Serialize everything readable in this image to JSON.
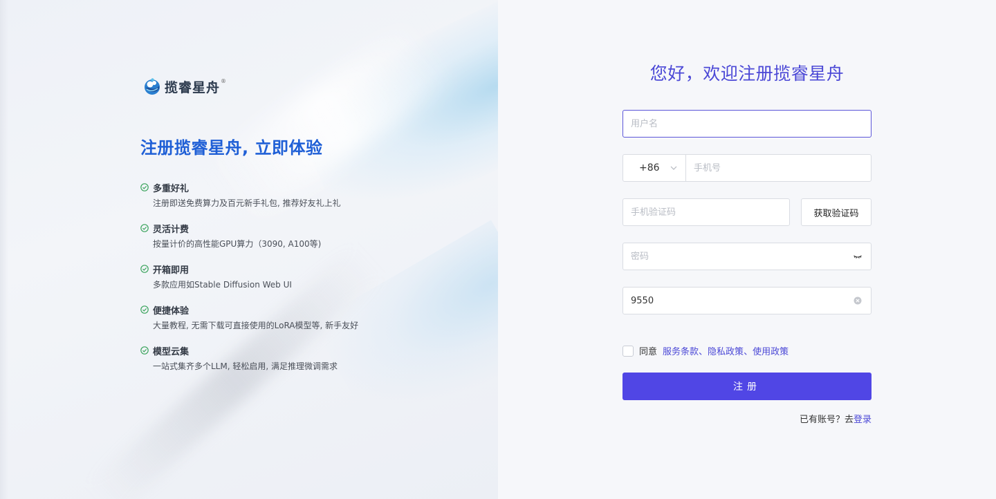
{
  "brand": {
    "logo_text": "揽睿星舟",
    "registered_mark": "®"
  },
  "hero": {
    "title": "注册揽睿星舟, 立即体验"
  },
  "features": [
    {
      "title": "多重好礼",
      "desc": "注册即送免费算力及百元新手礼包, 推荐好友礼上礼"
    },
    {
      "title": "灵活计费",
      "desc": "按量计价的高性能GPU算力（3090, A100等)"
    },
    {
      "title": "开箱即用",
      "desc": "多款应用如Stable Diffusion Web UI"
    },
    {
      "title": "便捷体验",
      "desc": "大量教程, 无需下载可直接使用的LoRA模型等, 新手友好"
    },
    {
      "title": "模型云集",
      "desc": "一站式集齐多个LLM, 轻松启用, 满足推理微调需求"
    }
  ],
  "form": {
    "title": "您好，欢迎注册揽睿星舟",
    "username": {
      "placeholder": "用户名",
      "value": ""
    },
    "country_code": "+86",
    "phone": {
      "placeholder": "手机号",
      "value": ""
    },
    "sms_code": {
      "placeholder": "手机验证码",
      "value": ""
    },
    "get_code_label": "获取验证码",
    "password": {
      "placeholder": "密码",
      "value": ""
    },
    "captcha": {
      "placeholder": "",
      "value": "9550"
    },
    "agree_prefix": "同意",
    "terms_link": "服务条款",
    "privacy_link": "隐私政策",
    "usage_link": "使用政策",
    "separator": "、",
    "submit_label": "注册",
    "have_account": "已有账号？去",
    "login_link": "登录"
  },
  "colors": {
    "accent": "#5046e5",
    "title": "#4b48d6",
    "hero": "#1f5fd6",
    "check": "#3aa35c"
  },
  "icons": {
    "feature_check": "check-circle-icon",
    "country_dropdown": "chevron-down-icon",
    "password_toggle": "eye-closed-icon",
    "captcha_clear": "clear-circle-icon"
  }
}
